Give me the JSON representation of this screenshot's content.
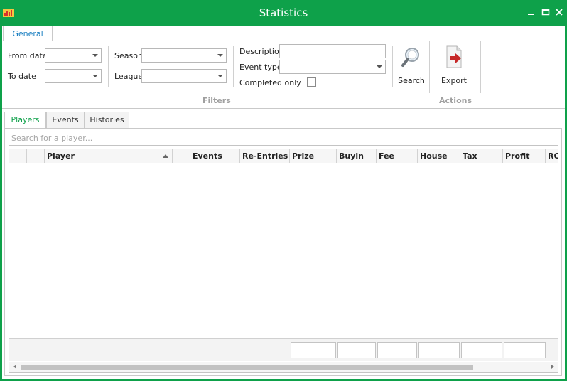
{
  "window": {
    "title": "Statistics",
    "accent": "#0ea14a"
  },
  "ribbon": {
    "tab": "General",
    "filters": {
      "from_date_label": "From date",
      "to_date_label": "To date",
      "season_label": "Season",
      "league_label": "League",
      "description_label": "Description",
      "event_type_label": "Event type",
      "completed_only_label": "Completed only",
      "search_label": "Search",
      "group_label": "Filters"
    },
    "actions": {
      "export_label": "Export",
      "group_label": "Actions"
    }
  },
  "tabs": [
    "Players",
    "Events",
    "Histories"
  ],
  "players": {
    "search_placeholder": "Search for a player...",
    "columns": [
      "Player",
      "Events",
      "Re-Entries",
      "Prize",
      "Buyin",
      "Fee",
      "House",
      "Tax",
      "Profit",
      "RO"
    ]
  }
}
